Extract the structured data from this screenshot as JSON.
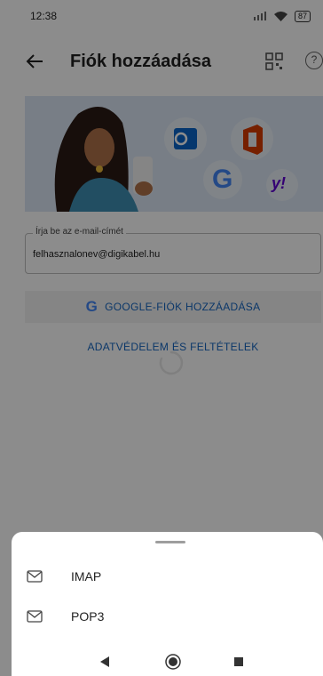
{
  "status_bar": {
    "time": "12:38",
    "battery": "87"
  },
  "app_bar": {
    "title": "Fiók hozzáadása",
    "help_symbol": "?"
  },
  "email_field": {
    "label": "Írja be az e-mail-címét",
    "value": "felhasznalonev@digikabel.hu"
  },
  "google_button": {
    "letter": "G",
    "label": "GOOGLE-FIÓK HOZZÁADÁSA"
  },
  "privacy_link": {
    "label": "ADATVÉDELEM ÉS FELTÉTELEK"
  },
  "sheet": {
    "options": [
      {
        "label": "IMAP",
        "icon": "mail-icon"
      },
      {
        "label": "POP3",
        "icon": "mail-icon"
      }
    ]
  },
  "hero_icons": {
    "google_letter": "G",
    "yahoo_text": "y!"
  },
  "colors": {
    "link_blue": "#1565c0",
    "outlook_blue": "#0a64c8",
    "office_red": "#d83b01",
    "yahoo_purple": "#6001d2",
    "hero_bg": "#dbe6f4"
  }
}
